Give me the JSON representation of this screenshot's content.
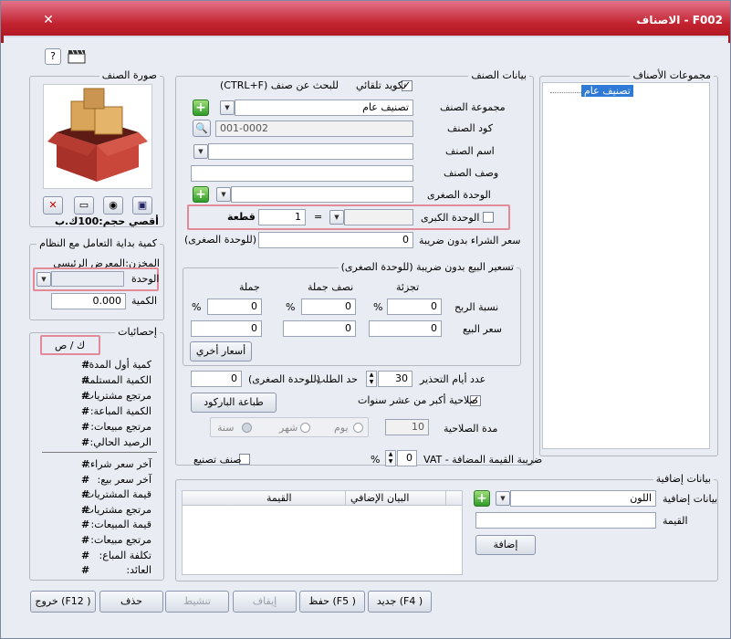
{
  "window": {
    "title": "F002 - الاصناف"
  },
  "toolbar": {
    "help_icon_label": "?"
  },
  "image_group": {
    "title": "صورة الصنف",
    "max_size": "أقصي حجم:100ك.ب"
  },
  "start_group": {
    "title": "كمية بداية التعامل مع النظام",
    "store_label": "المخزن:",
    "store_value": "المعرض الرئيسي",
    "unit_label": "الوحدة",
    "unit_value": "",
    "qty_label": "الكمية",
    "qty_value": "0.000"
  },
  "stats_group": {
    "title": "إحصائيات",
    "header": "ك / ص",
    "items1": [
      {
        "label": "كمية أول المدة:",
        "value": "#"
      },
      {
        "label": "الكمية المستلمة:",
        "value": "#"
      },
      {
        "label": "مرتجع مشتريات:",
        "value": "#"
      },
      {
        "label": "الكمية المباعة:",
        "value": "#"
      },
      {
        "label": "مرتجع مبيعات:",
        "value": "#"
      },
      {
        "label": "الرصيد الحالي:",
        "value": "#"
      }
    ],
    "items2": [
      {
        "label": "آخر سعر شراء:",
        "value": "#"
      },
      {
        "label": "آخر سعر بيع:",
        "value": "#"
      },
      {
        "label": "قيمة المشتريات:",
        "value": "#"
      },
      {
        "label": "مرتجع مشتريات:",
        "value": "#"
      },
      {
        "label": "قيمة المبيعات:",
        "value": "#"
      },
      {
        "label": "مرتجع مبيعات:",
        "value": "#"
      },
      {
        "label": "تكلفة المباع:",
        "value": "#"
      },
      {
        "label": "العائد:",
        "value": "#"
      }
    ]
  },
  "item_group": {
    "title": "بيانات الصنف",
    "auto_code_label": "تكويد تلقائي",
    "search_hint": "للبحث عن صنف (CTRL+F)",
    "group_label": "مجموعة الصنف",
    "group_value": "تصنيف عام",
    "code_label": "كود الصنف",
    "code_value": "001-0002",
    "name_label": "اسم الصنف",
    "name_value": "",
    "desc_label": "وصف الصنف",
    "desc_value": "",
    "small_unit_label": "الوحدة الصغرى",
    "small_unit_value": "",
    "big_unit_label": "الوحدة الكبرى",
    "big_unit_value": "",
    "eq": "=",
    "big_unit_factor": "1",
    "piece_label": "قطعة",
    "purchase_label": "سعر الشراء بدون ضريبة",
    "purchase_unit": "(للوحدة الصغرى)",
    "purchase_value": "0"
  },
  "pricing_group": {
    "title": "تسعير البيع بدون ضريبة (للوحدة الصغرى)",
    "col_retail": "تجزئة",
    "col_half": "نصف جملة",
    "col_whole": "جملة",
    "margin_label": "نسبة الربح",
    "price_label": "سعر البيع",
    "pct": "%",
    "margin_retail": "0",
    "margin_half": "0",
    "margin_whole": "0",
    "price_retail": "0",
    "price_half": "0",
    "price_whole": "0",
    "other_prices_btn": "أسعار أخري"
  },
  "misc": {
    "warn_days_label": "عدد أيام التحذير",
    "warn_days_value": "30",
    "order_limit_label": "حد الطلب",
    "order_limit_unit": "(للوحدة الصغرى)",
    "order_limit_value": "0",
    "print_barcode_btn": "طباعة الباركود",
    "validity_10y_label": "صلاحية أكبر من عشر سنوات",
    "day": "يوم",
    "month": "شهر",
    "year": "سنة",
    "validity_label": "مدة الصلاحية",
    "validity_value": "10",
    "vat_label": "ضريبة القيمة المضافة - VAT",
    "vat_value": "0",
    "vat_pct": "%",
    "manufactured_label": "صنف تصنيع"
  },
  "groups_panel": {
    "title": "مجموعات الأصناف",
    "tree_item": "تصنيف عام"
  },
  "extra_group": {
    "title": "بيانات إضافية",
    "extra_label": "بيانات إضافية",
    "extra_value": "اللون",
    "value_label": "القيمة",
    "value_value": "",
    "add_btn": "إضافة",
    "grid_col1": "البيان الإضافي",
    "grid_col2": "القيمة"
  },
  "footer": {
    "new_btn": "جديد (F4 )",
    "save_btn": "حفظ (F5 )",
    "stop_btn": "إيقاف",
    "activate_btn": "تنشيط",
    "delete_btn": "حذف",
    "exit_btn": "خروج (F12 )"
  }
}
